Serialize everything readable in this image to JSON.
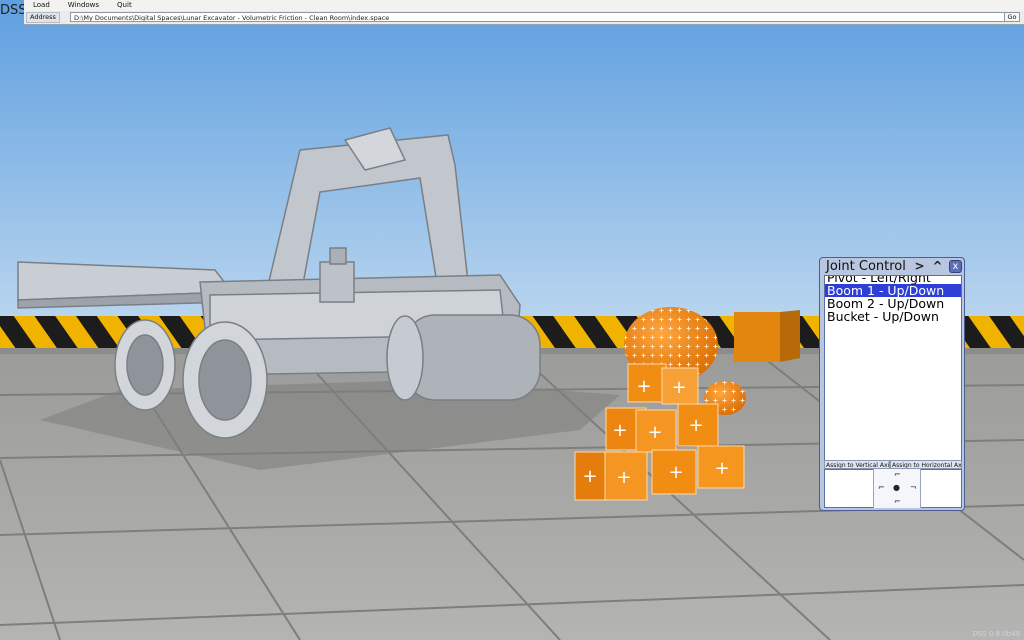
{
  "app": {
    "logo_text": "DSS"
  },
  "menu": [
    "Load",
    "Windows",
    "Quit"
  ],
  "address": {
    "label": "Address",
    "value": "D:\\My Documents\\Digital Spaces\\Lunar Excavator - Volumetric Friction - Clean Room\\index.space",
    "go_label": "Go"
  },
  "joint_panel": {
    "title": "Joint Control",
    "next_glyph": ">",
    "up_glyph": "^",
    "close_glyph": "x",
    "items": [
      {
        "label": "Pivot - Left/Right",
        "selected": false
      },
      {
        "label": "Boom 1 - Up/Down",
        "selected": true
      },
      {
        "label": "Boom 2 - Up/Down",
        "selected": false
      },
      {
        "label": "Bucket - Up/Down",
        "selected": false
      }
    ],
    "assign_vertical": "Assign to Vertical Axis",
    "assign_horizontal": "Assign to Horizontal Axis"
  },
  "version": "DSS 0.8.0b49",
  "colors": {
    "sky_top": "#5e9fe0",
    "sky_bottom": "#b8d4ee",
    "floor": "#a4a4a2",
    "hazard_yellow": "#f0b400",
    "cube_orange": "#f08a14",
    "selection_blue": "#2d3fd6"
  }
}
